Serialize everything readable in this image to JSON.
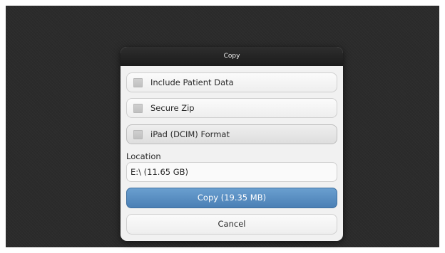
{
  "dialog": {
    "title": "Copy",
    "options": [
      {
        "label": "Include Patient Data",
        "checked": false
      },
      {
        "label": "Secure Zip",
        "checked": false
      },
      {
        "label": "iPad (DCIM) Format",
        "checked": false
      }
    ],
    "location_label": "Location",
    "location_value": "E:\\ (11.65 GB)",
    "copy_button": "Copy (19.35 MB)",
    "cancel_button": "Cancel"
  },
  "colors": {
    "primary_button": "#4a7fb5",
    "titlebar": "#1b1b1b",
    "background": "#2b2b2b"
  }
}
